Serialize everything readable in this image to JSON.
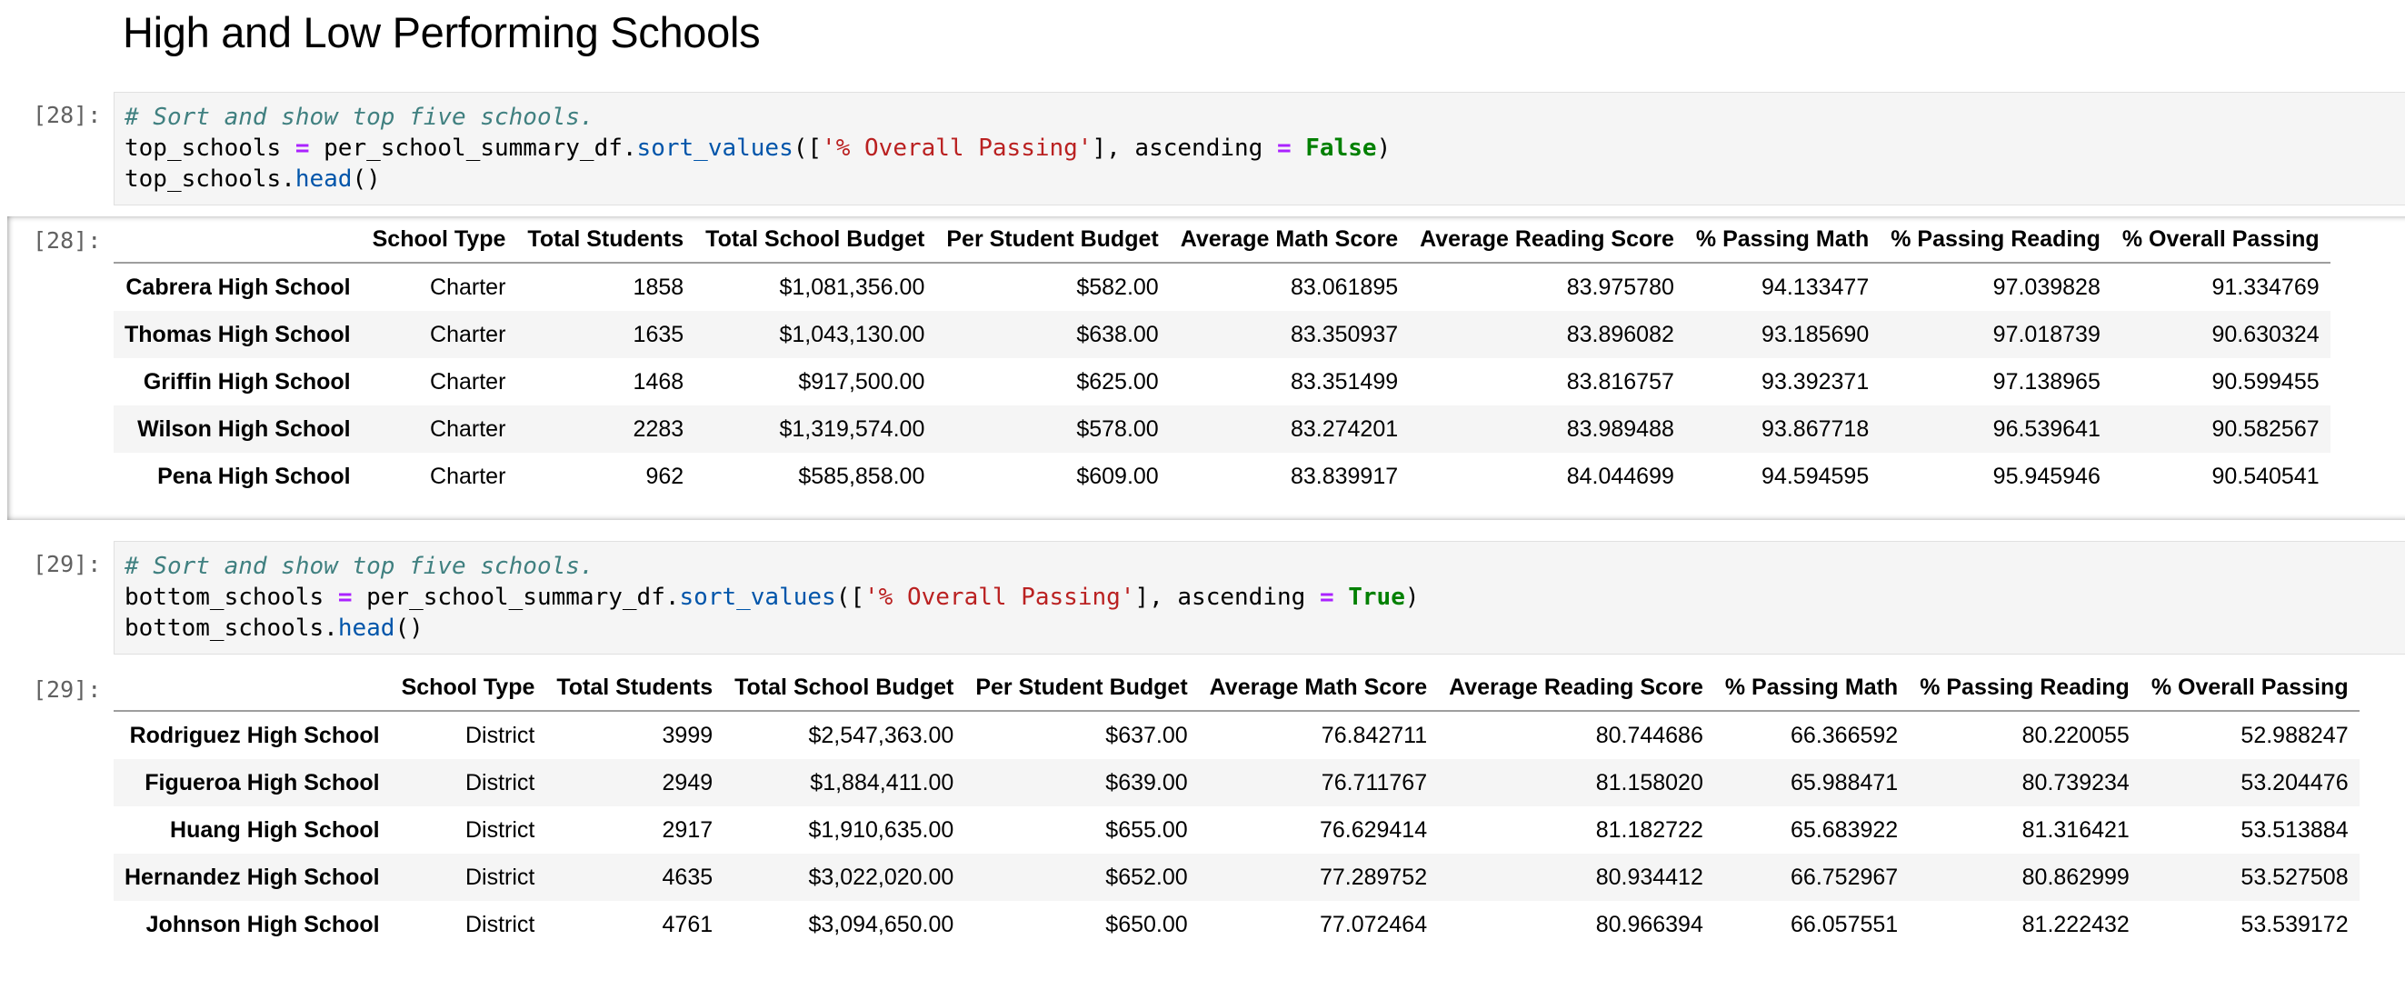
{
  "heading": "High and Low Performing Schools",
  "cells": [
    {
      "prompt": "[28]:",
      "out_prompt": "[28]:",
      "code": {
        "comment": "# Sort and show top five schools.",
        "var": "top_schools",
        "assign": "=",
        "obj": "per_school_summary_df",
        "method": "sort_values",
        "open": "([",
        "arg": "'% Overall Passing'",
        "close_list": "], ascending ",
        "eq": "=",
        "bool": "False",
        "close": ")",
        "var2": "top_schools",
        "method2": "head",
        "call2": "()"
      }
    },
    {
      "prompt": "[29]:",
      "out_prompt": "[29]:",
      "code": {
        "comment": "# Sort and show top five schools.",
        "var": "bottom_schools",
        "assign": "=",
        "obj": "per_school_summary_df",
        "method": "sort_values",
        "open": "([",
        "arg": "'% Overall Passing'",
        "close_list": "], ascending ",
        "eq": "=",
        "bool": "True",
        "close": ")",
        "var2": "bottom_schools",
        "method2": "head",
        "call2": "()"
      }
    }
  ],
  "columns": [
    "School Type",
    "Total Students",
    "Total School Budget",
    "Per Student Budget",
    "Average Math Score",
    "Average Reading Score",
    "% Passing Math",
    "% Passing Reading",
    "% Overall Passing"
  ],
  "top_rows": [
    [
      "Cabrera High School",
      "Charter",
      "1858",
      "$1,081,356.00",
      "$582.00",
      "83.061895",
      "83.975780",
      "94.133477",
      "97.039828",
      "91.334769"
    ],
    [
      "Thomas High School",
      "Charter",
      "1635",
      "$1,043,130.00",
      "$638.00",
      "83.350937",
      "83.896082",
      "93.185690",
      "97.018739",
      "90.630324"
    ],
    [
      "Griffin High School",
      "Charter",
      "1468",
      "$917,500.00",
      "$625.00",
      "83.351499",
      "83.816757",
      "93.392371",
      "97.138965",
      "90.599455"
    ],
    [
      "Wilson High School",
      "Charter",
      "2283",
      "$1,319,574.00",
      "$578.00",
      "83.274201",
      "83.989488",
      "93.867718",
      "96.539641",
      "90.582567"
    ],
    [
      "Pena High School",
      "Charter",
      "962",
      "$585,858.00",
      "$609.00",
      "83.839917",
      "84.044699",
      "94.594595",
      "95.945946",
      "90.540541"
    ]
  ],
  "bottom_rows": [
    [
      "Rodriguez High School",
      "District",
      "3999",
      "$2,547,363.00",
      "$637.00",
      "76.842711",
      "80.744686",
      "66.366592",
      "80.220055",
      "52.988247"
    ],
    [
      "Figueroa High School",
      "District",
      "2949",
      "$1,884,411.00",
      "$639.00",
      "76.711767",
      "81.158020",
      "65.988471",
      "80.739234",
      "53.204476"
    ],
    [
      "Huang High School",
      "District",
      "2917",
      "$1,910,635.00",
      "$655.00",
      "76.629414",
      "81.182722",
      "65.683922",
      "81.316421",
      "53.513884"
    ],
    [
      "Hernandez High School",
      "District",
      "4635",
      "$3,022,020.00",
      "$652.00",
      "77.289752",
      "80.934412",
      "66.752967",
      "80.862999",
      "53.527508"
    ],
    [
      "Johnson High School",
      "District",
      "4761",
      "$3,094,650.00",
      "$650.00",
      "77.072464",
      "80.966394",
      "66.057551",
      "81.222432",
      "53.539172"
    ]
  ]
}
